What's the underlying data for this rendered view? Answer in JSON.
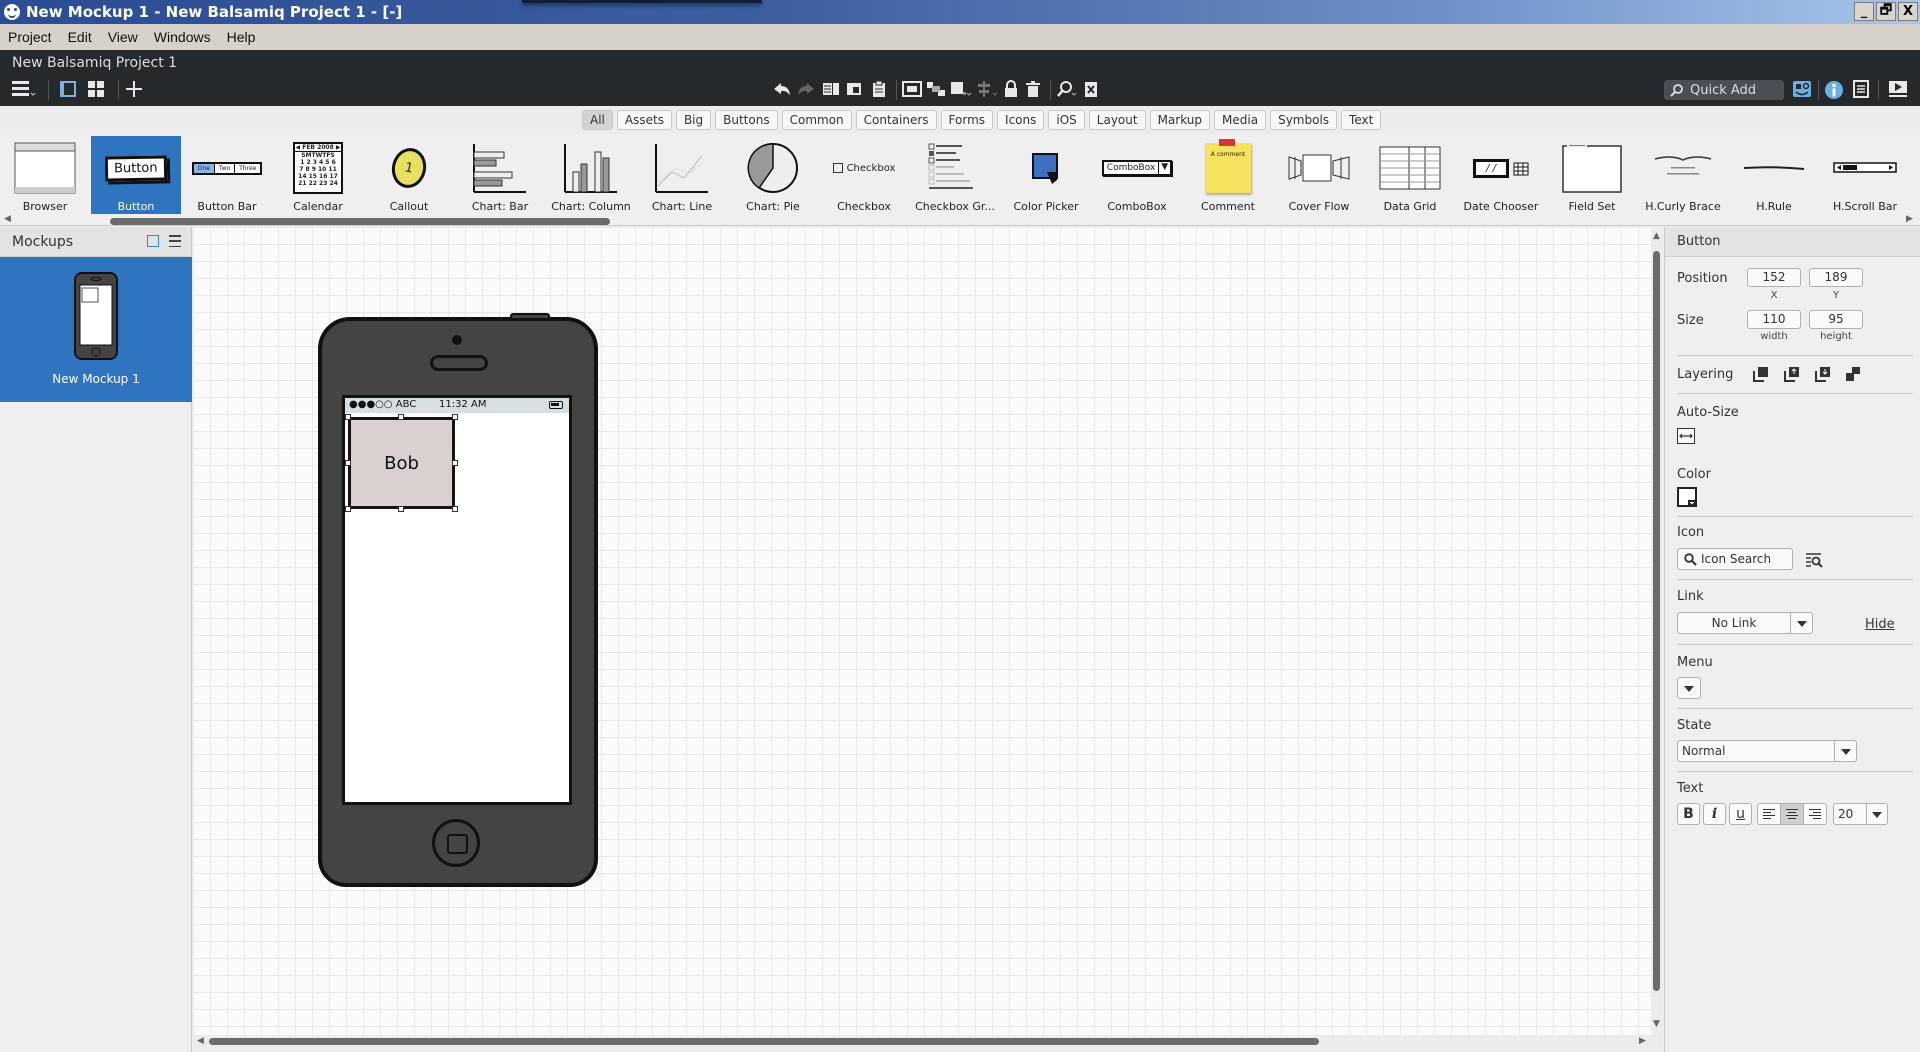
{
  "window": {
    "title": "New Mockup 1 - New Balsamiq Project 1 - [-]",
    "controls": {
      "minimize": "_",
      "restore": "🗗",
      "close": "X"
    }
  },
  "menubar": [
    "Project",
    "Edit",
    "View",
    "Windows",
    "Help"
  ],
  "header": {
    "project_name": "New Balsamiq Project 1",
    "quick_add_placeholder": "Quick Add",
    "left_icons": [
      "menu-icon",
      "single-view-icon",
      "grid-view-icon",
      "add-icon"
    ],
    "center_icons": [
      "undo-icon",
      "redo-icon",
      "copy-icon",
      "duplicate-icon",
      "paste-icon",
      "group-icon",
      "ungroup-icon",
      "arrange-icon",
      "align-icon",
      "lock-icon",
      "delete-icon",
      "find-icon",
      "clear-icon"
    ],
    "right_icons": [
      "ui-library-icon",
      "info-icon",
      "notes-icon",
      "present-icon"
    ]
  },
  "filter_tabs": [
    {
      "label": "All",
      "active": true
    },
    {
      "label": "Assets"
    },
    {
      "label": "Big"
    },
    {
      "label": "Buttons"
    },
    {
      "label": "Common"
    },
    {
      "label": "Containers"
    },
    {
      "label": "Forms"
    },
    {
      "label": "Icons"
    },
    {
      "label": "iOS"
    },
    {
      "label": "Layout"
    },
    {
      "label": "Markup"
    },
    {
      "label": "Media"
    },
    {
      "label": "Symbols"
    },
    {
      "label": "Text"
    }
  ],
  "library": [
    {
      "label": "Browser"
    },
    {
      "label": "Button",
      "selected": true,
      "thumb_text": "Button"
    },
    {
      "label": "Button Bar",
      "thumb_text": [
        "One",
        "Two",
        "Three"
      ]
    },
    {
      "label": "Calendar",
      "thumb_text": "FEB 2008"
    },
    {
      "label": "Callout",
      "thumb_text": "1"
    },
    {
      "label": "Chart: Bar"
    },
    {
      "label": "Chart: Column"
    },
    {
      "label": "Chart: Line"
    },
    {
      "label": "Chart: Pie"
    },
    {
      "label": "Checkbox",
      "thumb_text": "Checkbox"
    },
    {
      "label": "Checkbox Gr..."
    },
    {
      "label": "Color Picker"
    },
    {
      "label": "ComboBox",
      "thumb_text": "ComboBox"
    },
    {
      "label": "Comment",
      "thumb_text": "A comment"
    },
    {
      "label": "Cover Flow"
    },
    {
      "label": "Data Grid"
    },
    {
      "label": "Date Chooser",
      "thumb_text": "/ /"
    },
    {
      "label": "Field Set"
    },
    {
      "label": "H.Curly Brace"
    },
    {
      "label": "H.Rule"
    },
    {
      "label": "H.Scroll Bar"
    }
  ],
  "sidebar": {
    "title": "Mockups",
    "items": [
      {
        "label": "New Mockup 1",
        "selected": true
      }
    ]
  },
  "canvas": {
    "status_signal": "●●●○○ ABC",
    "status_time": "11:32 AM",
    "button_text": "Bob"
  },
  "properties": {
    "title": "Button",
    "position_label": "Position",
    "x": "152",
    "x_label": "X",
    "y": "189",
    "y_label": "Y",
    "size_label": "Size",
    "width": "110",
    "width_label": "width",
    "height": "95",
    "height_label": "height",
    "layering_label": "Layering",
    "autosize_label": "Auto-Size",
    "color_label": "Color",
    "icon_label": "Icon",
    "icon_search_placeholder": "Icon Search",
    "link_label": "Link",
    "link_value": "No Link",
    "hide_label": "Hide",
    "menu_label": "Menu",
    "state_label": "State",
    "state_value": "Normal",
    "text_label": "Text",
    "bold": "B",
    "italic": "i",
    "underline": "u",
    "font_size": "20",
    "text_align": "center"
  },
  "colors": {
    "selection_blue": "#2f74bf",
    "header_dark": "#26292c",
    "button_fill": "#d8d1d0"
  }
}
